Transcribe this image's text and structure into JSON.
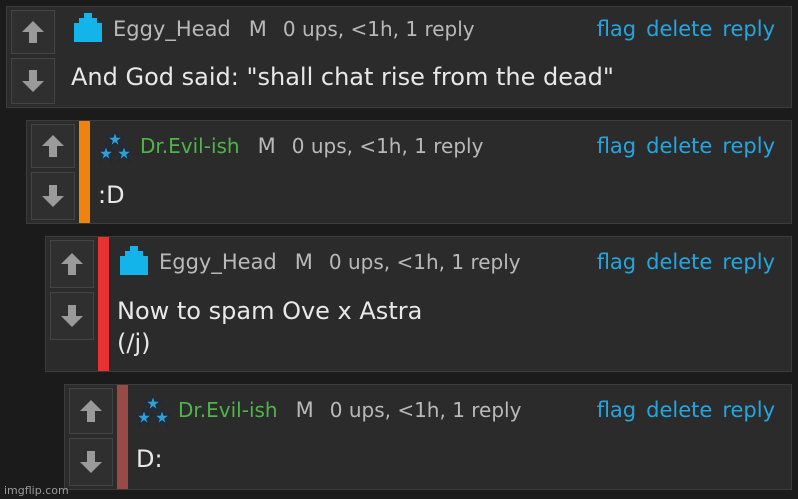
{
  "comments": [
    {
      "username": "Eggy_Head",
      "badge": "M",
      "meta": "0 ups, <1h, 1 reply",
      "actions": {
        "flag": "flag",
        "delete": "delete",
        "reply": "reply"
      },
      "text": "And God said: \"shall chat rise from the dead\"",
      "avatar": "blue-cross-avatar-icon",
      "username_color": "#b9b9b9"
    },
    {
      "username": "Dr.Evil-ish",
      "badge": "M",
      "meta": "0 ups, <1h, 1 reply",
      "actions": {
        "flag": "flag",
        "delete": "delete",
        "reply": "reply"
      },
      "text": ":D",
      "avatar": "three-stars-avatar-icon",
      "bar_color": "#f0820f",
      "username_color": "#4fb548"
    },
    {
      "username": "Eggy_Head",
      "badge": "M",
      "meta": "0 ups, <1h, 1 reply",
      "actions": {
        "flag": "flag",
        "delete": "delete",
        "reply": "reply"
      },
      "text": "Now to spam Ove x Astra\n(/j)",
      "avatar": "blue-cross-avatar-icon",
      "bar_color": "#e83232",
      "username_color": "#b9b9b9"
    },
    {
      "username": "Dr.Evil-ish",
      "badge": "M",
      "meta": "0 ups, <1h, 1 reply",
      "actions": {
        "flag": "flag",
        "delete": "delete",
        "reply": "reply"
      },
      "text": "D:",
      "avatar": "three-stars-avatar-icon",
      "bar_color": "#9a4a46",
      "username_color": "#4fb548"
    }
  ],
  "watermark": "imgflip.com",
  "colors": {
    "link": "#23a6e0",
    "background": "#1b1b1b",
    "panel": "#2b2b2b"
  }
}
